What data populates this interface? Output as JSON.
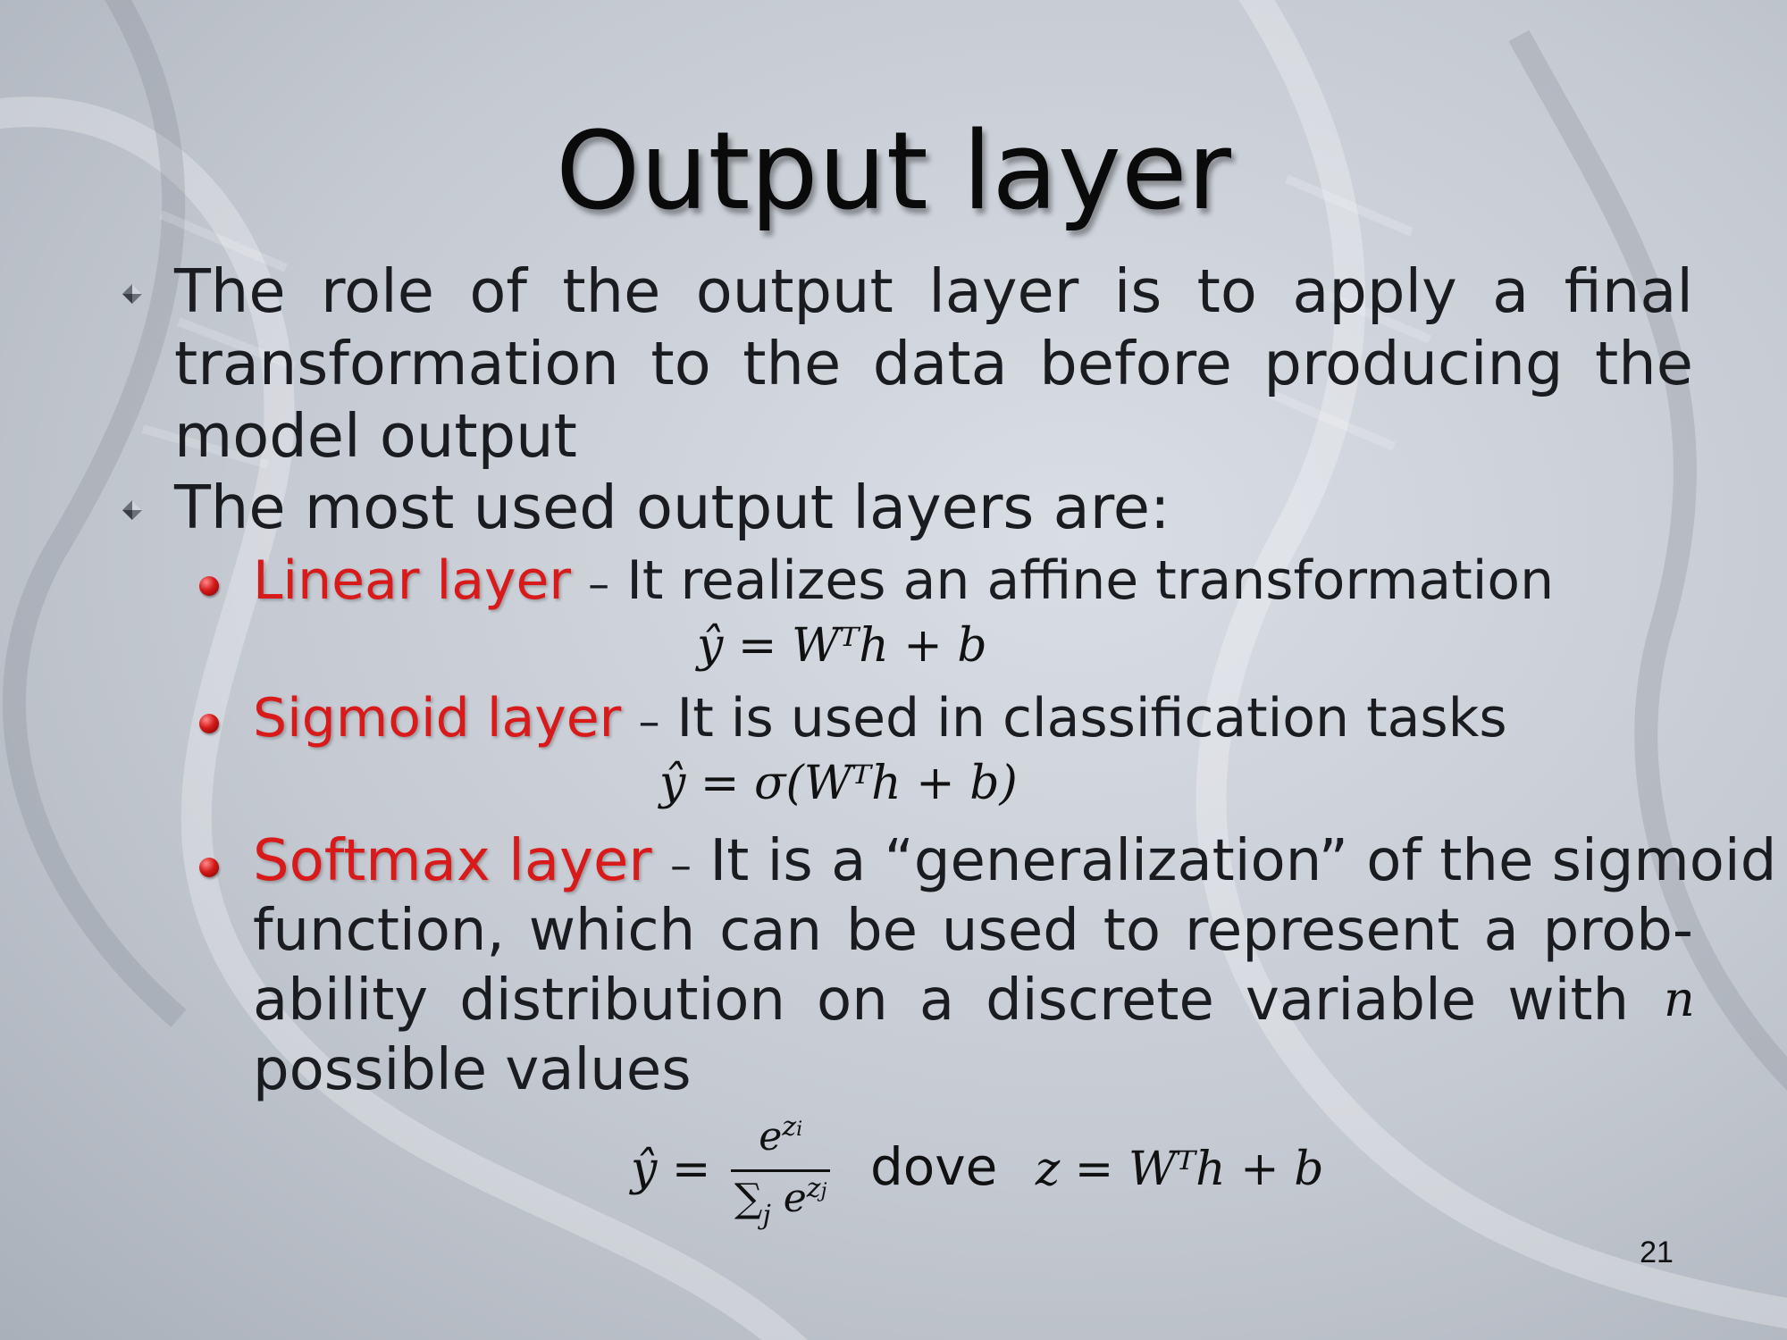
{
  "slide": {
    "title": "Output layer",
    "bullets": [
      {
        "lines": [
          "The role of the output layer is to apply a final",
          "transformation to the data before producing the",
          "model output"
        ]
      },
      {
        "lines": [
          "The most used output layers are:"
        ]
      }
    ],
    "sub_bullets": [
      {
        "name": "Linear layer",
        "dash": "–",
        "desc": "It realizes an affine transformation",
        "formula": "ŷ = Wᵀh + b"
      },
      {
        "name": "Sigmoid layer",
        "dash": "–",
        "desc": "It is used in classification tasks",
        "formula": "ŷ = σ(Wᵀh + b)"
      },
      {
        "name": "Softmax layer",
        "dash": "–",
        "desc_first": "It is a “generalization” of the sigmoid",
        "desc_lines": [
          "function, which can be used to represent a prob-",
          "ability distribution on a discrete variable with",
          "possible values"
        ],
        "var_n": "n",
        "formula": {
          "lhs": "ŷ =",
          "num_base": "e",
          "num_exp": "z",
          "num_exp_sub": "i",
          "den_sum": "∑",
          "den_sum_sub": "j",
          "den_base": "e",
          "den_exp": "z",
          "den_exp_sub": "j",
          "word": "dove",
          "rhs": "z = Wᵀh + b"
        }
      }
    ],
    "page_number": "21"
  },
  "colors": {
    "accent_red": "#d81a1a",
    "text": "#1a1c20",
    "background": "#c5cad2"
  }
}
